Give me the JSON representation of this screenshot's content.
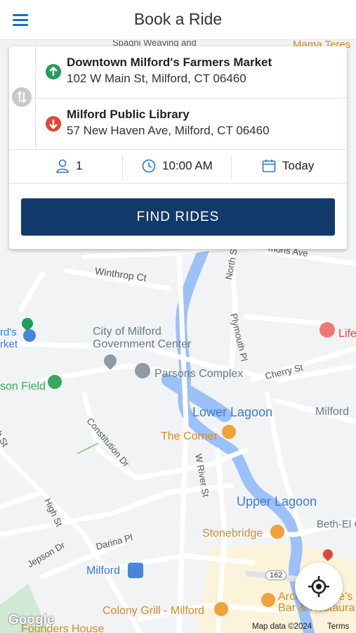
{
  "header": {
    "title": "Book a Ride",
    "menu_icon": "hamburger-menu-icon"
  },
  "trip": {
    "origin": {
      "name": "Downtown Milford's Farmers Market",
      "address": "102 W Main St, Milford, CT 06460",
      "icon": "arrow-up-circle-icon",
      "color": "#1e9e5a"
    },
    "destination": {
      "name": "Milford Public Library",
      "address": "57 New Haven Ave, Milford, CT 06460",
      "icon": "arrow-down-circle-icon",
      "color": "#e0463a"
    },
    "passengers": "1",
    "time": "10:00 AM",
    "date": "Today",
    "find_label": "FIND RIDES"
  },
  "map": {
    "labels": {
      "winthrop": "Winthrop Ct",
      "north": "North St",
      "plymouth": "Plymouth Pl",
      "cherry": "Cherry St",
      "city1": "City of Milford",
      "city2": "Government Center",
      "parsons": "Parsons Complex",
      "lower_lagoon": "Lower Lagoon",
      "upper_lagoon": "Upper Lagoon",
      "corner": "The Corner",
      "constitution": "Constitution Dr",
      "wriver": "W River St",
      "high": "High St",
      "jepson": "Jepson Dr",
      "darina": "Darina Pl",
      "milford": "Milford",
      "stonebridge": "Stonebridge",
      "colony": "Colony Grill - Milford",
      "founders": "Founders House",
      "milford_right": "Milford",
      "beth": "Beth-El Cen",
      "arch1": "Archie Moore's",
      "arch2": "Bar & Restaura",
      "life": "Life",
      "mama": "Mama Teres",
      "fields_frag": "son Field",
      "market_frag1": "rd's",
      "market_frag2": "rket",
      "commons": "mons Ave",
      "gh_frag": "gh St",
      "spagni": "Spagni Weaving and",
      "route": "162"
    },
    "attribution": "Map data ©2024",
    "terms": "Terms",
    "google": "Google",
    "locate_icon": "crosshair-locate-icon"
  }
}
